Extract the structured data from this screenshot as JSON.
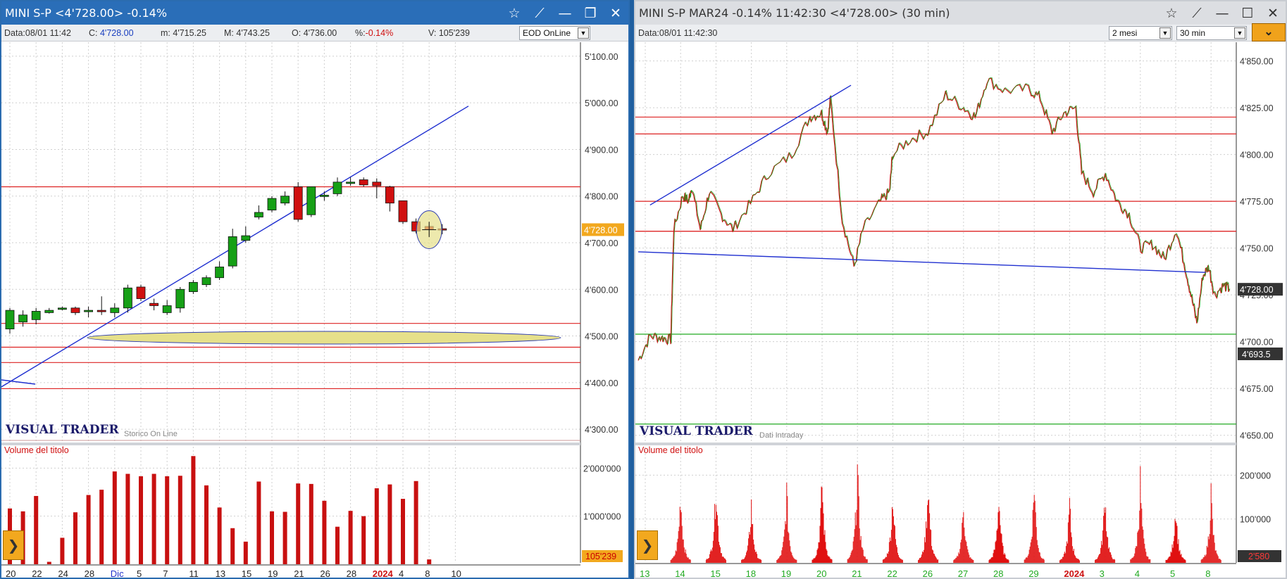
{
  "left": {
    "title": "MINI S-P <4'728.00> -0.14%",
    "info": {
      "date_label": "Data:",
      "date_value": "08/01 11:42",
      "close_label": "C:",
      "close_value": "4'728.00",
      "min_label": "m:",
      "min_value": "4'715.25",
      "max_label": "M:",
      "max_value": "4'743.25",
      "open_label": "O:",
      "open_value": "4'736.00",
      "pct_label": "%:",
      "pct_value": "-0.14%",
      "vol_label": "V:",
      "vol_value": "105'239"
    },
    "source_select": "EOD OnLine",
    "watermark": "VISUAL TRADER",
    "watermark_sub": "Storico On Line",
    "volume_title": "Volume del titolo",
    "price_tag": "4'728.00",
    "volume_tag": "105'239",
    "price_axis": [
      "5'100.00",
      "5'000.00",
      "4'900.00",
      "4'800.00",
      "4'700.00",
      "4'600.00",
      "4'500.00",
      "4'400.00",
      "4'300.00"
    ],
    "volume_axis": [
      "2'000'000",
      "1'000'000"
    ],
    "x_labels": [
      {
        "t": "20",
        "i": 0
      },
      {
        "t": "22",
        "i": 2
      },
      {
        "t": "24",
        "i": 4
      },
      {
        "t": "28",
        "i": 6
      },
      {
        "t": "Dic",
        "i": 8,
        "c": "#2233cc"
      },
      {
        "t": "5",
        "i": 10
      },
      {
        "t": "7",
        "i": 12
      },
      {
        "t": "11",
        "i": 14
      },
      {
        "t": "13",
        "i": 16
      },
      {
        "t": "15",
        "i": 18
      },
      {
        "t": "19",
        "i": 20
      },
      {
        "t": "21",
        "i": 22
      },
      {
        "t": "26",
        "i": 24
      },
      {
        "t": "28",
        "i": 26
      },
      {
        "t": "2024",
        "i": 28,
        "c": "#cc1111",
        "b": 1
      },
      {
        "t": "4",
        "i": 30
      },
      {
        "t": "8",
        "i": 32
      },
      {
        "t": "10",
        "i": 34
      }
    ]
  },
  "right": {
    "title": "MINI S-P MAR24 -0.14% 11:42:30  <4'728.00> (30 min)",
    "date_label": "Data:",
    "date_value": "08/01 11:42:30",
    "range_select": "2 mesi",
    "tf_select": "30 min",
    "watermark": "VISUAL TRADER",
    "watermark_sub": "Dati Intraday",
    "volume_title": "Volume del titolo",
    "price_tag": "4'728.00",
    "level_tag": "4'693.5",
    "volume_tag": "2'580",
    "price_axis": [
      "4'850.00",
      "4'825.00",
      "4'800.00",
      "4'775.00",
      "4'750.00",
      "4'725.00",
      "4'700.00",
      "4'675.00",
      "4'650.00"
    ],
    "volume_axis": [
      "200'000",
      "100'000"
    ],
    "x_labels": [
      {
        "t": "13",
        "c": "#22aa22"
      },
      {
        "t": "14",
        "c": "#22aa22"
      },
      {
        "t": "15",
        "c": "#22aa22"
      },
      {
        "t": "18",
        "c": "#22aa22"
      },
      {
        "t": "19",
        "c": "#22aa22"
      },
      {
        "t": "20",
        "c": "#22aa22"
      },
      {
        "t": "21",
        "c": "#22aa22"
      },
      {
        "t": "22",
        "c": "#22aa22"
      },
      {
        "t": "26",
        "c": "#22aa22"
      },
      {
        "t": "27",
        "c": "#22aa22"
      },
      {
        "t": "28",
        "c": "#22aa22"
      },
      {
        "t": "29",
        "c": "#22aa22"
      },
      {
        "t": "2024",
        "c": "#cc1111",
        "b": 1
      },
      {
        "t": "3",
        "c": "#22aa22"
      },
      {
        "t": "4",
        "c": "#22aa22"
      },
      {
        "t": "5",
        "c": "#22aa22"
      },
      {
        "t": "8",
        "c": "#22aa22"
      }
    ]
  },
  "chart_data": [
    {
      "type": "candlestick",
      "series_label": "MINI S-P (daily)",
      "ylim": [
        4270,
        5130
      ],
      "price_hlines": [
        4820,
        4527,
        4476,
        4443,
        4387
      ],
      "trendline": [
        [
          -2,
          4368
        ],
        [
          35,
          4993
        ]
      ],
      "ohlc": [
        [
          4515,
          4560,
          4505,
          4555
        ],
        [
          4530,
          4555,
          4520,
          4545
        ],
        [
          4535,
          4560,
          4525,
          4553
        ],
        [
          4550,
          4560,
          4548,
          4555
        ],
        [
          4557,
          4563,
          4555,
          4560
        ],
        [
          4560,
          4563,
          4545,
          4550
        ],
        [
          4552,
          4563,
          4540,
          4555
        ],
        [
          4555,
          4585,
          4545,
          4553
        ],
        [
          4550,
          4570,
          4540,
          4560
        ],
        [
          4560,
          4610,
          4550,
          4603
        ],
        [
          4605,
          4610,
          4575,
          4580
        ],
        [
          4570,
          4580,
          4555,
          4565
        ],
        [
          4550,
          4577,
          4545,
          4565
        ],
        [
          4560,
          4605,
          4550,
          4600
        ],
        [
          4595,
          4620,
          4590,
          4615
        ],
        [
          4610,
          4630,
          4605,
          4625
        ],
        [
          4625,
          4660,
          4620,
          4648
        ],
        [
          4650,
          4730,
          4645,
          4713
        ],
        [
          4705,
          4735,
          4700,
          4715
        ],
        [
          4755,
          4780,
          4750,
          4765
        ],
        [
          4770,
          4800,
          4765,
          4795
        ],
        [
          4785,
          4810,
          4780,
          4800
        ],
        [
          4820,
          4830,
          4745,
          4750
        ],
        [
          4760,
          4820,
          4755,
          4820
        ],
        [
          4800,
          4810,
          4790,
          4802
        ],
        [
          4805,
          4840,
          4800,
          4830
        ],
        [
          4830,
          4840,
          4822,
          4830
        ],
        [
          4835,
          4840,
          4820,
          4824
        ],
        [
          4830,
          4838,
          4795,
          4822
        ],
        [
          4820,
          4822,
          4767,
          4785
        ],
        [
          4790,
          4790,
          4740,
          4745
        ],
        [
          4745,
          4752,
          4720,
          4725
        ],
        [
          4735,
          4743,
          4715,
          4728
        ],
        [
          4730,
          4740,
          4718,
          4728
        ]
      ],
      "volume": [
        1160000,
        1100000,
        1420000,
        50000,
        550000,
        1080000,
        1440000,
        1550000,
        1930000,
        1880000,
        1830000,
        1880000,
        1830000,
        1840000,
        2250000,
        1640000,
        1180000,
        750000,
        470000,
        1720000,
        1100000,
        1090000,
        1680000,
        1670000,
        1320000,
        780000,
        1110000,
        1000000,
        1580000,
        1660000,
        1360000,
        1730000,
        100000
      ]
    },
    {
      "type": "line",
      "series_label": "MINI S-P MAR24 (30 min)",
      "ylim": [
        4645,
        4860
      ],
      "price_hlines": [
        4820,
        4811,
        4775,
        4759,
        4759
      ],
      "green_hlines": [
        4704,
        4656
      ],
      "trendline": [
        [
          0.02,
          4773
        ],
        [
          0.36,
          4837
        ]
      ],
      "trendline2": [
        [
          0.0,
          4748
        ],
        [
          0.96,
          4737
        ]
      ],
      "keypoints": [
        [
          0.0,
          4690
        ],
        [
          0.02,
          4703
        ],
        [
          0.04,
          4702
        ],
        [
          0.055,
          4701
        ],
        [
          0.06,
          4760
        ],
        [
          0.075,
          4778
        ],
        [
          0.085,
          4775
        ],
        [
          0.09,
          4783
        ],
        [
          0.105,
          4760
        ],
        [
          0.12,
          4780
        ],
        [
          0.14,
          4768
        ],
        [
          0.16,
          4760
        ],
        [
          0.19,
          4774
        ],
        [
          0.22,
          4790
        ],
        [
          0.26,
          4800
        ],
        [
          0.29,
          4820
        ],
        [
          0.31,
          4822
        ],
        [
          0.32,
          4812
        ],
        [
          0.325,
          4830
        ],
        [
          0.345,
          4765
        ],
        [
          0.365,
          4740
        ],
        [
          0.38,
          4760
        ],
        [
          0.41,
          4775
        ],
        [
          0.425,
          4780
        ],
        [
          0.43,
          4800
        ],
        [
          0.46,
          4808
        ],
        [
          0.49,
          4812
        ],
        [
          0.52,
          4832
        ],
        [
          0.55,
          4825
        ],
        [
          0.57,
          4820
        ],
        [
          0.59,
          4840
        ],
        [
          0.62,
          4834
        ],
        [
          0.66,
          4835
        ],
        [
          0.68,
          4830
        ],
        [
          0.7,
          4812
        ],
        [
          0.72,
          4822
        ],
        [
          0.74,
          4825
        ],
        [
          0.75,
          4790
        ],
        [
          0.77,
          4780
        ],
        [
          0.79,
          4790
        ],
        [
          0.81,
          4775
        ],
        [
          0.83,
          4768
        ],
        [
          0.85,
          4750
        ],
        [
          0.87,
          4752
        ],
        [
          0.89,
          4744
        ],
        [
          0.91,
          4760
        ],
        [
          0.925,
          4740
        ],
        [
          0.935,
          4725
        ],
        [
          0.945,
          4710
        ],
        [
          0.955,
          4735
        ],
        [
          0.965,
          4740
        ],
        [
          0.975,
          4725
        ],
        [
          0.99,
          4730
        ],
        [
          1.0,
          4728
        ]
      ]
    }
  ]
}
